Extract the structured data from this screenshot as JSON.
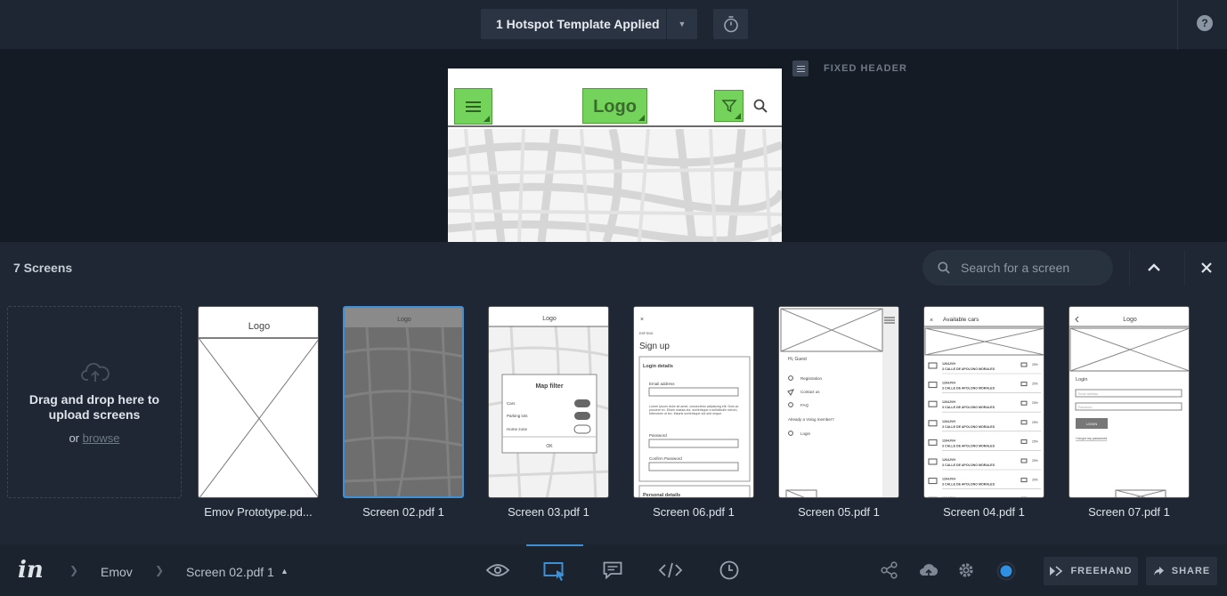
{
  "topbar": {
    "template_label": "1 Hotspot Template Applied",
    "help_label": "?"
  },
  "canvas": {
    "logo_label": "Logo",
    "fixed_header_label": "FIXED HEADER"
  },
  "panel": {
    "title": "7 Screens",
    "search_placeholder": "Search for a screen",
    "dropzone_text": "Drag and drop here to upload screens",
    "dropzone_or": "or",
    "dropzone_browse": "browse",
    "screens": [
      {
        "label": "Emov Prototype.pd..."
      },
      {
        "label": "Screen 02.pdf 1"
      },
      {
        "label": "Screen 03.pdf 1"
      },
      {
        "label": "Screen 06.pdf 1"
      },
      {
        "label": "Screen 05.pdf 1"
      },
      {
        "label": "Screen 04.pdf 1"
      },
      {
        "label": "Screen 07.pdf 1"
      }
    ],
    "thumb_text": {
      "logo": "Logo",
      "map_filter": "Map filter",
      "cars": "Cars",
      "parking_lots": "Parking lots",
      "home_zone": "Home zone",
      "ok": "OK",
      "esp_eng": "ESP ENG",
      "sign_up": "Sign up",
      "login_details": "Login details",
      "email_address": "Email address",
      "lorem": "Lorem ipsum dolor sit amet, consectetur adipiscing elit. Duis ac posuere ex. Etiam massa dui, scelerisque a sollicitudin rutrum, bibendum ut leo. Mauris scelerisque dui sed neque.",
      "password": "Password",
      "confirm_password": "Confirm Password",
      "personal_details": "Personal details",
      "hi_guest": "Hi, Guest",
      "registration": "Registration",
      "contact_us": "Contact us",
      "faq": "FAQ",
      "already_member": "Already a Volog member?",
      "login": "Login",
      "available_cars": "Available cars",
      "car_code": "1264JVH",
      "car_address": "3 CALLE DE APOLONO MORALES",
      "car_pct": "25%",
      "email_ph": "Email address",
      "password_ph": "Password",
      "login_btn": "LOGIN",
      "forgot": "I forgot my password"
    }
  },
  "bottombar": {
    "logo": "in",
    "breadcrumb_project": "Emov",
    "breadcrumb_screen": "Screen 02.pdf 1",
    "freehand_label": "FREEHAND",
    "share_label": "SHARE"
  },
  "colors": {
    "accent": "#3d8fd6",
    "hotspot": "#74d35a",
    "background": "#141b24"
  }
}
